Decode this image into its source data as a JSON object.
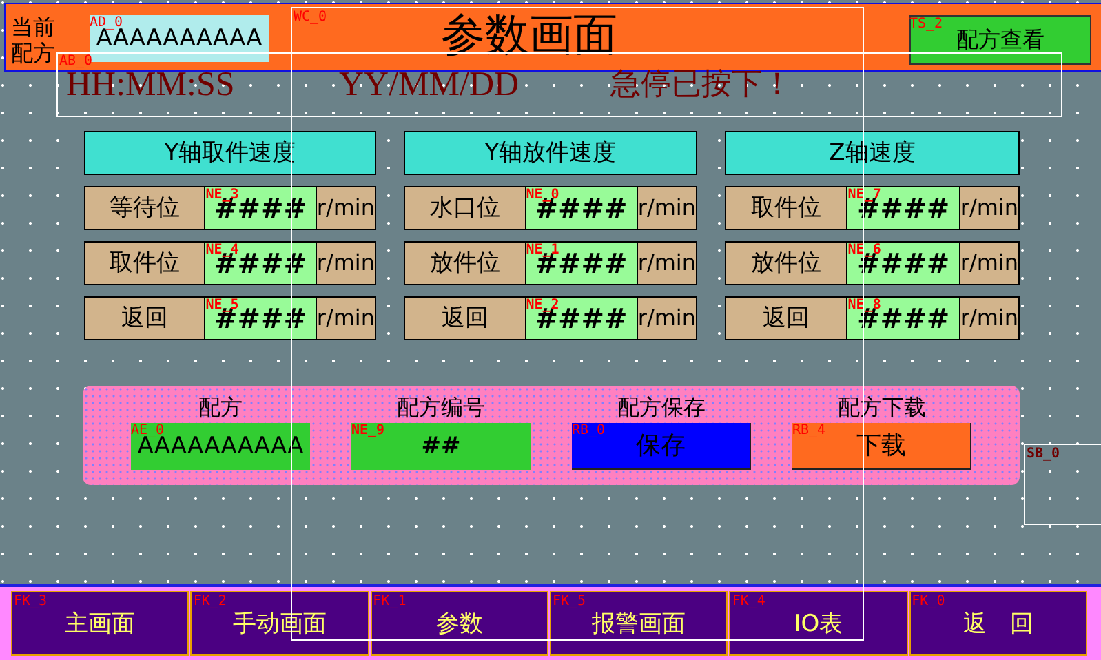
{
  "header": {
    "label": "当前配方",
    "recipe_field": {
      "tag": "AD_0",
      "value": "AAAAAAAAAA"
    },
    "title": "参数画面",
    "view_button": {
      "tag": "TS_2",
      "label": "配方查看"
    }
  },
  "status": {
    "time": "HH:MM:SS",
    "date": "YY/MM/DD",
    "alarm": "急停已按下！"
  },
  "outlines": [
    {
      "kind": "window",
      "tag": "WC_0"
    },
    {
      "kind": "status",
      "tag": "AB_0"
    },
    {
      "kind": "side",
      "tag": "SB_0"
    }
  ],
  "groups": [
    {
      "title": "Y轴取件速度",
      "rows": [
        {
          "label": "等待位",
          "tag": "NE_3",
          "value": "####",
          "unit": "r/min"
        },
        {
          "label": "取件位",
          "tag": "NE_4",
          "value": "####",
          "unit": "r/min"
        },
        {
          "label": "返回",
          "tag": "NE_5",
          "value": "####",
          "unit": "r/min"
        }
      ]
    },
    {
      "title": "Y轴放件速度",
      "rows": [
        {
          "label": "水口位",
          "tag": "NE_0",
          "value": "####",
          "unit": "r/min"
        },
        {
          "label": "放件位",
          "tag": "NE_1",
          "value": "####",
          "unit": "r/min"
        },
        {
          "label": "返回",
          "tag": "NE_2",
          "value": "####",
          "unit": "r/min"
        }
      ]
    },
    {
      "title": "Z轴速度",
      "rows": [
        {
          "label": "取件位",
          "tag": "NE_7",
          "value": "####",
          "unit": "r/min"
        },
        {
          "label": "放件位",
          "tag": "NE_6",
          "value": "####",
          "unit": "r/min"
        },
        {
          "label": "返回",
          "tag": "NE_8",
          "value": "####",
          "unit": "r/min"
        }
      ]
    }
  ],
  "recipe_panel": [
    {
      "kind": "text_field",
      "caption": "配方",
      "tag": "AE_0",
      "value": "AAAAAAAAAA"
    },
    {
      "kind": "number_field",
      "caption": "配方编号",
      "tag": "NE_9",
      "value": "##"
    },
    {
      "kind": "button",
      "caption": "配方保存",
      "tag": "RB_0",
      "label": "保存",
      "color": "#0000ff"
    },
    {
      "kind": "button",
      "caption": "配方下载",
      "tag": "RB_4",
      "label": "下载",
      "color": "#ff6a1f"
    }
  ],
  "nav": [
    {
      "tag": "FK_3",
      "label": "主画面"
    },
    {
      "tag": "FK_2",
      "label": "手动画面"
    },
    {
      "tag": "FK_1",
      "label": "参数"
    },
    {
      "tag": "FK_5",
      "label": "报警画面"
    },
    {
      "tag": "FK_4",
      "label": "IO表"
    },
    {
      "tag": "FK_0",
      "label": "返　回"
    }
  ]
}
